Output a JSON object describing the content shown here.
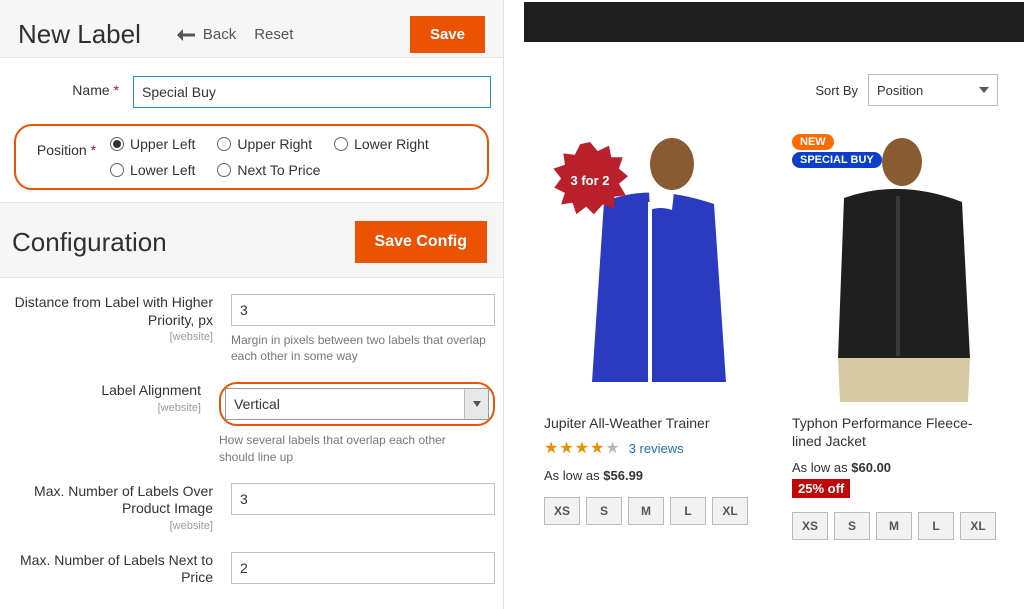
{
  "colors": {
    "primary": "#eb5202"
  },
  "header": {
    "title": "New Label",
    "back": "Back",
    "reset": "Reset",
    "save": "Save"
  },
  "form": {
    "name_label": "Name",
    "name_value": "Special Buy",
    "position_label": "Position",
    "positions": [
      "Upper Left",
      "Upper Right",
      "Lower Right",
      "Lower Left",
      "Next To Price"
    ],
    "position_selected": "Upper Left"
  },
  "config": {
    "title": "Configuration",
    "save": "Save Config",
    "rows": {
      "distance": {
        "label": "Distance from Label with Higher Priority, px",
        "scope": "[website]",
        "value": "3",
        "help": "Margin in pixels between two labels that overlap each other in some way"
      },
      "alignment": {
        "label": "Label Alignment",
        "scope": "[website]",
        "value": "Vertical",
        "help": "How several labels that overlap each other should line up"
      },
      "max_image": {
        "label": "Max. Number of Labels Over Product Image",
        "scope": "[website]",
        "value": "3"
      },
      "max_price": {
        "label": "Max. Number of Labels Next to Price",
        "value": "2"
      }
    }
  },
  "storefront": {
    "sort_label": "Sort By",
    "sort_value": "Position",
    "products": [
      {
        "name": "Jupiter All-Weather Trainer",
        "badge_starburst": "3 for 2",
        "rating_full": 4,
        "rating_empty": 1,
        "reviews": "3 reviews",
        "price_prefix": "As low as",
        "price": "$56.99",
        "sizes": [
          "XS",
          "S",
          "M",
          "L",
          "XL"
        ]
      },
      {
        "name": "Typhon Performance Fleece-lined Jacket",
        "pill_new": "NEW",
        "pill_special": "SPECIAL BUY",
        "price_prefix": "As low as",
        "price": "$60.00",
        "discount": "25% off",
        "sizes": [
          "XS",
          "S",
          "M",
          "L",
          "XL"
        ]
      }
    ]
  }
}
